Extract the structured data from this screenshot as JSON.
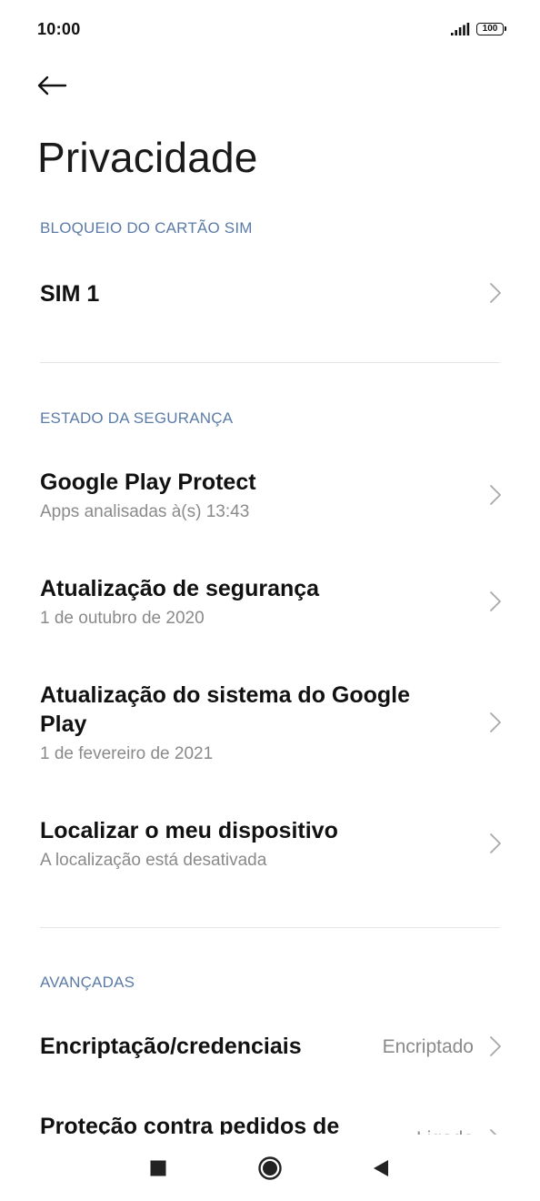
{
  "status_bar": {
    "time": "10:00",
    "battery": "100"
  },
  "header": {
    "title": "Privacidade"
  },
  "sections": {
    "sim_lock": {
      "header": "BLOQUEIO DO CARTÃO SIM",
      "items": [
        {
          "title": "SIM 1"
        }
      ]
    },
    "security_status": {
      "header": "ESTADO DA SEGURANÇA",
      "items": [
        {
          "title": "Google Play Protect",
          "subtitle": "Apps analisadas à(s) 13:43"
        },
        {
          "title": "Atualização de segurança",
          "subtitle": "1 de outubro de 2020"
        },
        {
          "title": "Atualização do sistema do Google Play",
          "subtitle": "1 de fevereiro de 2021"
        },
        {
          "title": "Localizar o meu dispositivo",
          "subtitle": "A localização está desativada"
        }
      ]
    },
    "advanced": {
      "header": "AVANÇADAS",
      "items": [
        {
          "title": "Encriptação/credenciais",
          "value": "Encriptado"
        },
        {
          "title": "Proteção contra pedidos de",
          "value": "Ligado"
        }
      ]
    }
  },
  "colors": {
    "section_header": "#5b7ba8",
    "subtitle": "#8a8a8a",
    "divider": "#e6e6e6"
  },
  "icons": {
    "back": "arrow-left-icon",
    "chevron": "chevron-right-icon",
    "signal": "signal-icon",
    "nav_recents": "square-icon",
    "nav_home": "circle-icon",
    "nav_back": "triangle-back-icon"
  }
}
